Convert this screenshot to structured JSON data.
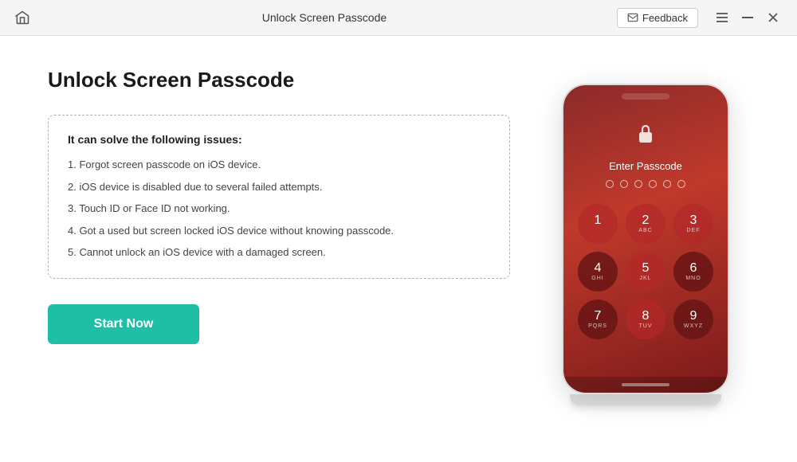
{
  "titlebar": {
    "title": "Unlock Screen Passcode",
    "feedback_label": "Feedback",
    "home_icon": "🏠"
  },
  "main": {
    "page_title": "Unlock Screen Passcode",
    "issues_box": {
      "header": "It can solve the following issues:",
      "items": [
        "1. Forgot screen passcode on iOS device.",
        "2. iOS device is disabled due to several failed attempts.",
        "3. Touch ID or Face ID not working.",
        "4. Got a used but screen locked iOS device without knowing passcode.",
        "5. Cannot unlock an iOS device with a damaged screen."
      ]
    },
    "start_button": "Start Now"
  },
  "phone": {
    "enter_text": "Enter Passcode",
    "lock_icon": "🔒",
    "keys": [
      {
        "num": "1",
        "letters": ""
      },
      {
        "num": "2",
        "letters": "ABC"
      },
      {
        "num": "3",
        "letters": "DEF"
      },
      {
        "num": "4",
        "letters": "GHI"
      },
      {
        "num": "5",
        "letters": "JKL"
      },
      {
        "num": "6",
        "letters": "MNO"
      },
      {
        "num": "7",
        "letters": "PQRS"
      },
      {
        "num": "8",
        "letters": "TUV"
      },
      {
        "num": "9",
        "letters": "WXYZ"
      }
    ]
  }
}
